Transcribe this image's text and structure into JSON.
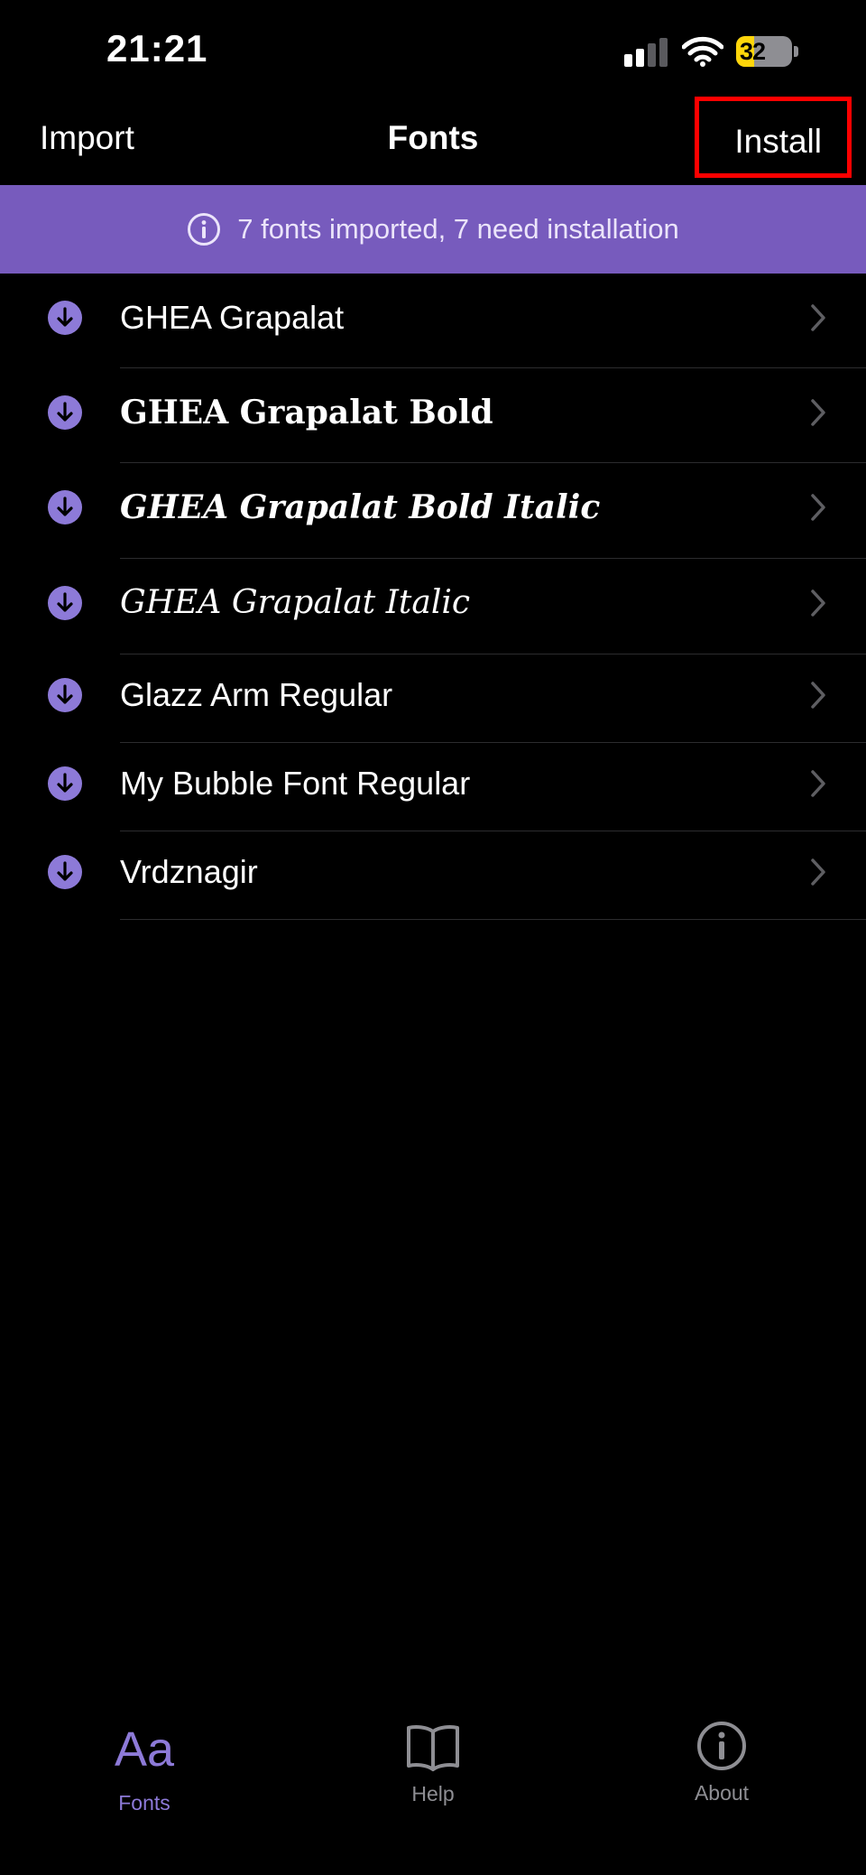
{
  "status_bar": {
    "time": "21:21",
    "battery_level": "32",
    "battery_fraction": 0.32
  },
  "nav_bar": {
    "import_label": "Import",
    "title": "Fonts",
    "install_label": "Install"
  },
  "banner": {
    "icon": "info-circle-icon",
    "text": "7 fonts imported, 7 need installation"
  },
  "fonts": [
    {
      "name": "GHEA Grapalat",
      "style": "regular",
      "icon": "download-arrow-icon"
    },
    {
      "name": "GHEA Grapalat Bold",
      "style": "bold",
      "icon": "download-arrow-icon"
    },
    {
      "name": "GHEA Grapalat Bold Italic",
      "style": "bold-italic",
      "icon": "download-arrow-icon"
    },
    {
      "name": "GHEA Grapalat Italic",
      "style": "italic",
      "icon": "download-arrow-icon"
    },
    {
      "name": "Glazz Arm Regular",
      "style": "regular",
      "icon": "download-arrow-icon"
    },
    {
      "name": "My Bubble Font Regular",
      "style": "regular",
      "icon": "download-arrow-icon"
    },
    {
      "name": "Vrdznagir",
      "style": "regular",
      "icon": "download-arrow-icon"
    }
  ],
  "tab_bar": {
    "tabs": [
      {
        "label": "Fonts",
        "glyph": "Aa",
        "selected": true
      },
      {
        "label": "Help",
        "icon": "book-icon",
        "selected": false
      },
      {
        "label": "About",
        "icon": "info-circle-icon",
        "selected": false
      }
    ]
  },
  "colors": {
    "accent": "#775bbd",
    "accent_icon": "#8d7ad8",
    "background": "#000000",
    "highlight_box": "#ff0000"
  }
}
